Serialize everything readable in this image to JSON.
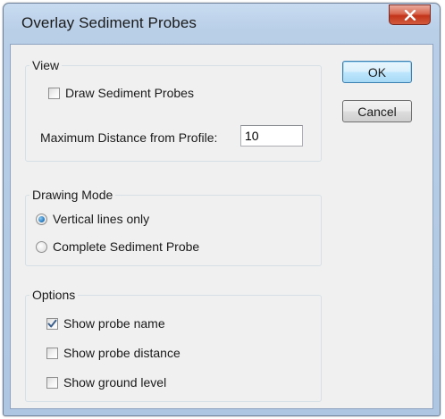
{
  "window": {
    "title": "Overlay Sediment Probes",
    "close_glyph": "x"
  },
  "buttons": {
    "ok_label": "OK",
    "cancel_label": "Cancel"
  },
  "view": {
    "title": "View",
    "draw_probes_label": "Draw Sediment Probes",
    "draw_probes_checked": false,
    "max_distance_label": "Maximum Distance from Profile:",
    "max_distance_value": "10"
  },
  "drawing_mode": {
    "title": "Drawing Mode",
    "options": [
      {
        "label": "Vertical lines only",
        "selected": true
      },
      {
        "label": "Complete Sediment Probe",
        "selected": false
      }
    ]
  },
  "options": {
    "title": "Options",
    "items": [
      {
        "label": "Show probe name",
        "checked": true
      },
      {
        "label": "Show probe distance",
        "checked": false
      },
      {
        "label": "Show ground level",
        "checked": false
      }
    ]
  },
  "colors": {
    "titlebar": "#b9cfe8",
    "dialog_background": "#f0f0f0",
    "close_button": "#c2351b",
    "default_button_border": "#3c7fb1",
    "radio_selected": "#2d7fc4"
  }
}
